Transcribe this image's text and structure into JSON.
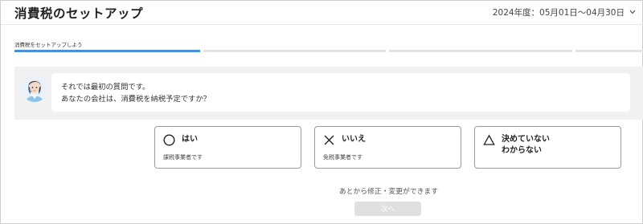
{
  "header": {
    "title": "消費税のセットアップ",
    "fiscal_year": "2024年度：05月01日～04月30日",
    "fiscal_year_icon": "chevron-down-icon"
  },
  "progress": {
    "step_label": "消費税をセットアップしよう",
    "segments_total": 4,
    "segments_completed": 1
  },
  "chat": {
    "avatar_icon": "assistant-avatar",
    "line1": "それでは最初の質問です。",
    "line2": "あなたの会社は、消費税を納税予定ですか？"
  },
  "options": [
    {
      "icon": "circle-icon",
      "label": "はい",
      "sub": "課税事業者です"
    },
    {
      "icon": "cross-icon",
      "label": "いいえ",
      "sub": "免税事業者です"
    },
    {
      "icon": "triangle-icon",
      "label_line1": "決めていない",
      "label_line2": "わからない"
    }
  ],
  "footer": {
    "note": "あとから修正・変更ができます",
    "next_label": "次へ"
  },
  "colors": {
    "progress_active": "#4a8ee0",
    "progress_inactive": "#e3e3e3",
    "chat_band": "#f1f1f1",
    "next_disabled": "#e0e0e0"
  }
}
